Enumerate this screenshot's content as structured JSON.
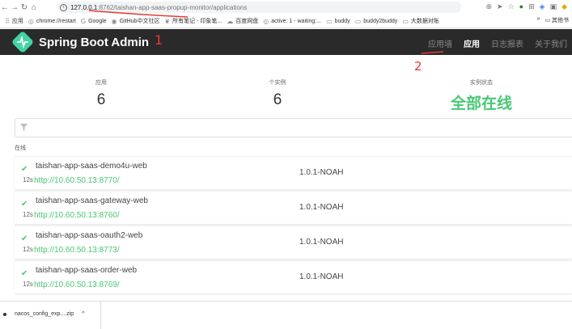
{
  "browser": {
    "url_host": "127.0.0.1",
    "url_path": ":8762/taishan-app-saas-propup-monitor/applications",
    "bookmarks": [
      {
        "icon": "grid-icon",
        "label": "应用"
      },
      {
        "icon": "globe-icon",
        "label": "chrome://restart"
      },
      {
        "icon": "google-icon",
        "label": "Google"
      },
      {
        "icon": "github-icon",
        "label": "GitHub中文社区"
      },
      {
        "icon": "elephant-icon",
        "label": "所有笔记 - 印象笔..."
      },
      {
        "icon": "cloud-icon",
        "label": "百度网盘"
      },
      {
        "icon": "globe-icon",
        "label": "active: 1 - waiting:..."
      },
      {
        "icon": "folder-icon",
        "label": "buddy"
      },
      {
        "icon": "folder-icon",
        "label": "buddy2buddy"
      },
      {
        "icon": "folder-icon",
        "label": "大数据对账"
      }
    ],
    "bookmarks_more": "»",
    "bookmarks_other": "其他书"
  },
  "app": {
    "title": "Spring Boot Admin",
    "nav": [
      "应用墙",
      "应用",
      "日志报表",
      "关于我们"
    ],
    "active_nav": "应用",
    "brand_color": "#42d3a5"
  },
  "annotations": {
    "one": "1",
    "two": "2"
  },
  "stats": {
    "apps_label": "应用",
    "apps_value": "6",
    "instances_label": "个实例",
    "instances_value": "6",
    "status_label": "实例状态",
    "status_value": "全部在线"
  },
  "section": {
    "online_label": "在线"
  },
  "apps": [
    {
      "name": "taishan-app-saas-demo4u-web",
      "ago": "12s",
      "url": "http://10.60.50.13:8770/",
      "version": "1.0.1-NOAH"
    },
    {
      "name": "taishan-app-saas-gateway-web",
      "ago": "12s",
      "url": "http://10.60.50.13:8760/",
      "version": "1.0.1-NOAH"
    },
    {
      "name": "taishan-app-saas-oauth2-web",
      "ago": "12s",
      "url": "http://10.60.50.13:8773/",
      "version": "1.0.1-NOAH"
    },
    {
      "name": "taishan-app-saas-order-web",
      "ago": "12s",
      "url": "http://10.60.50.13:8769/",
      "version": "1.0.1-NOAH"
    }
  ],
  "downloads": {
    "file": "nacos_config_exp....zip",
    "caret": "^"
  }
}
